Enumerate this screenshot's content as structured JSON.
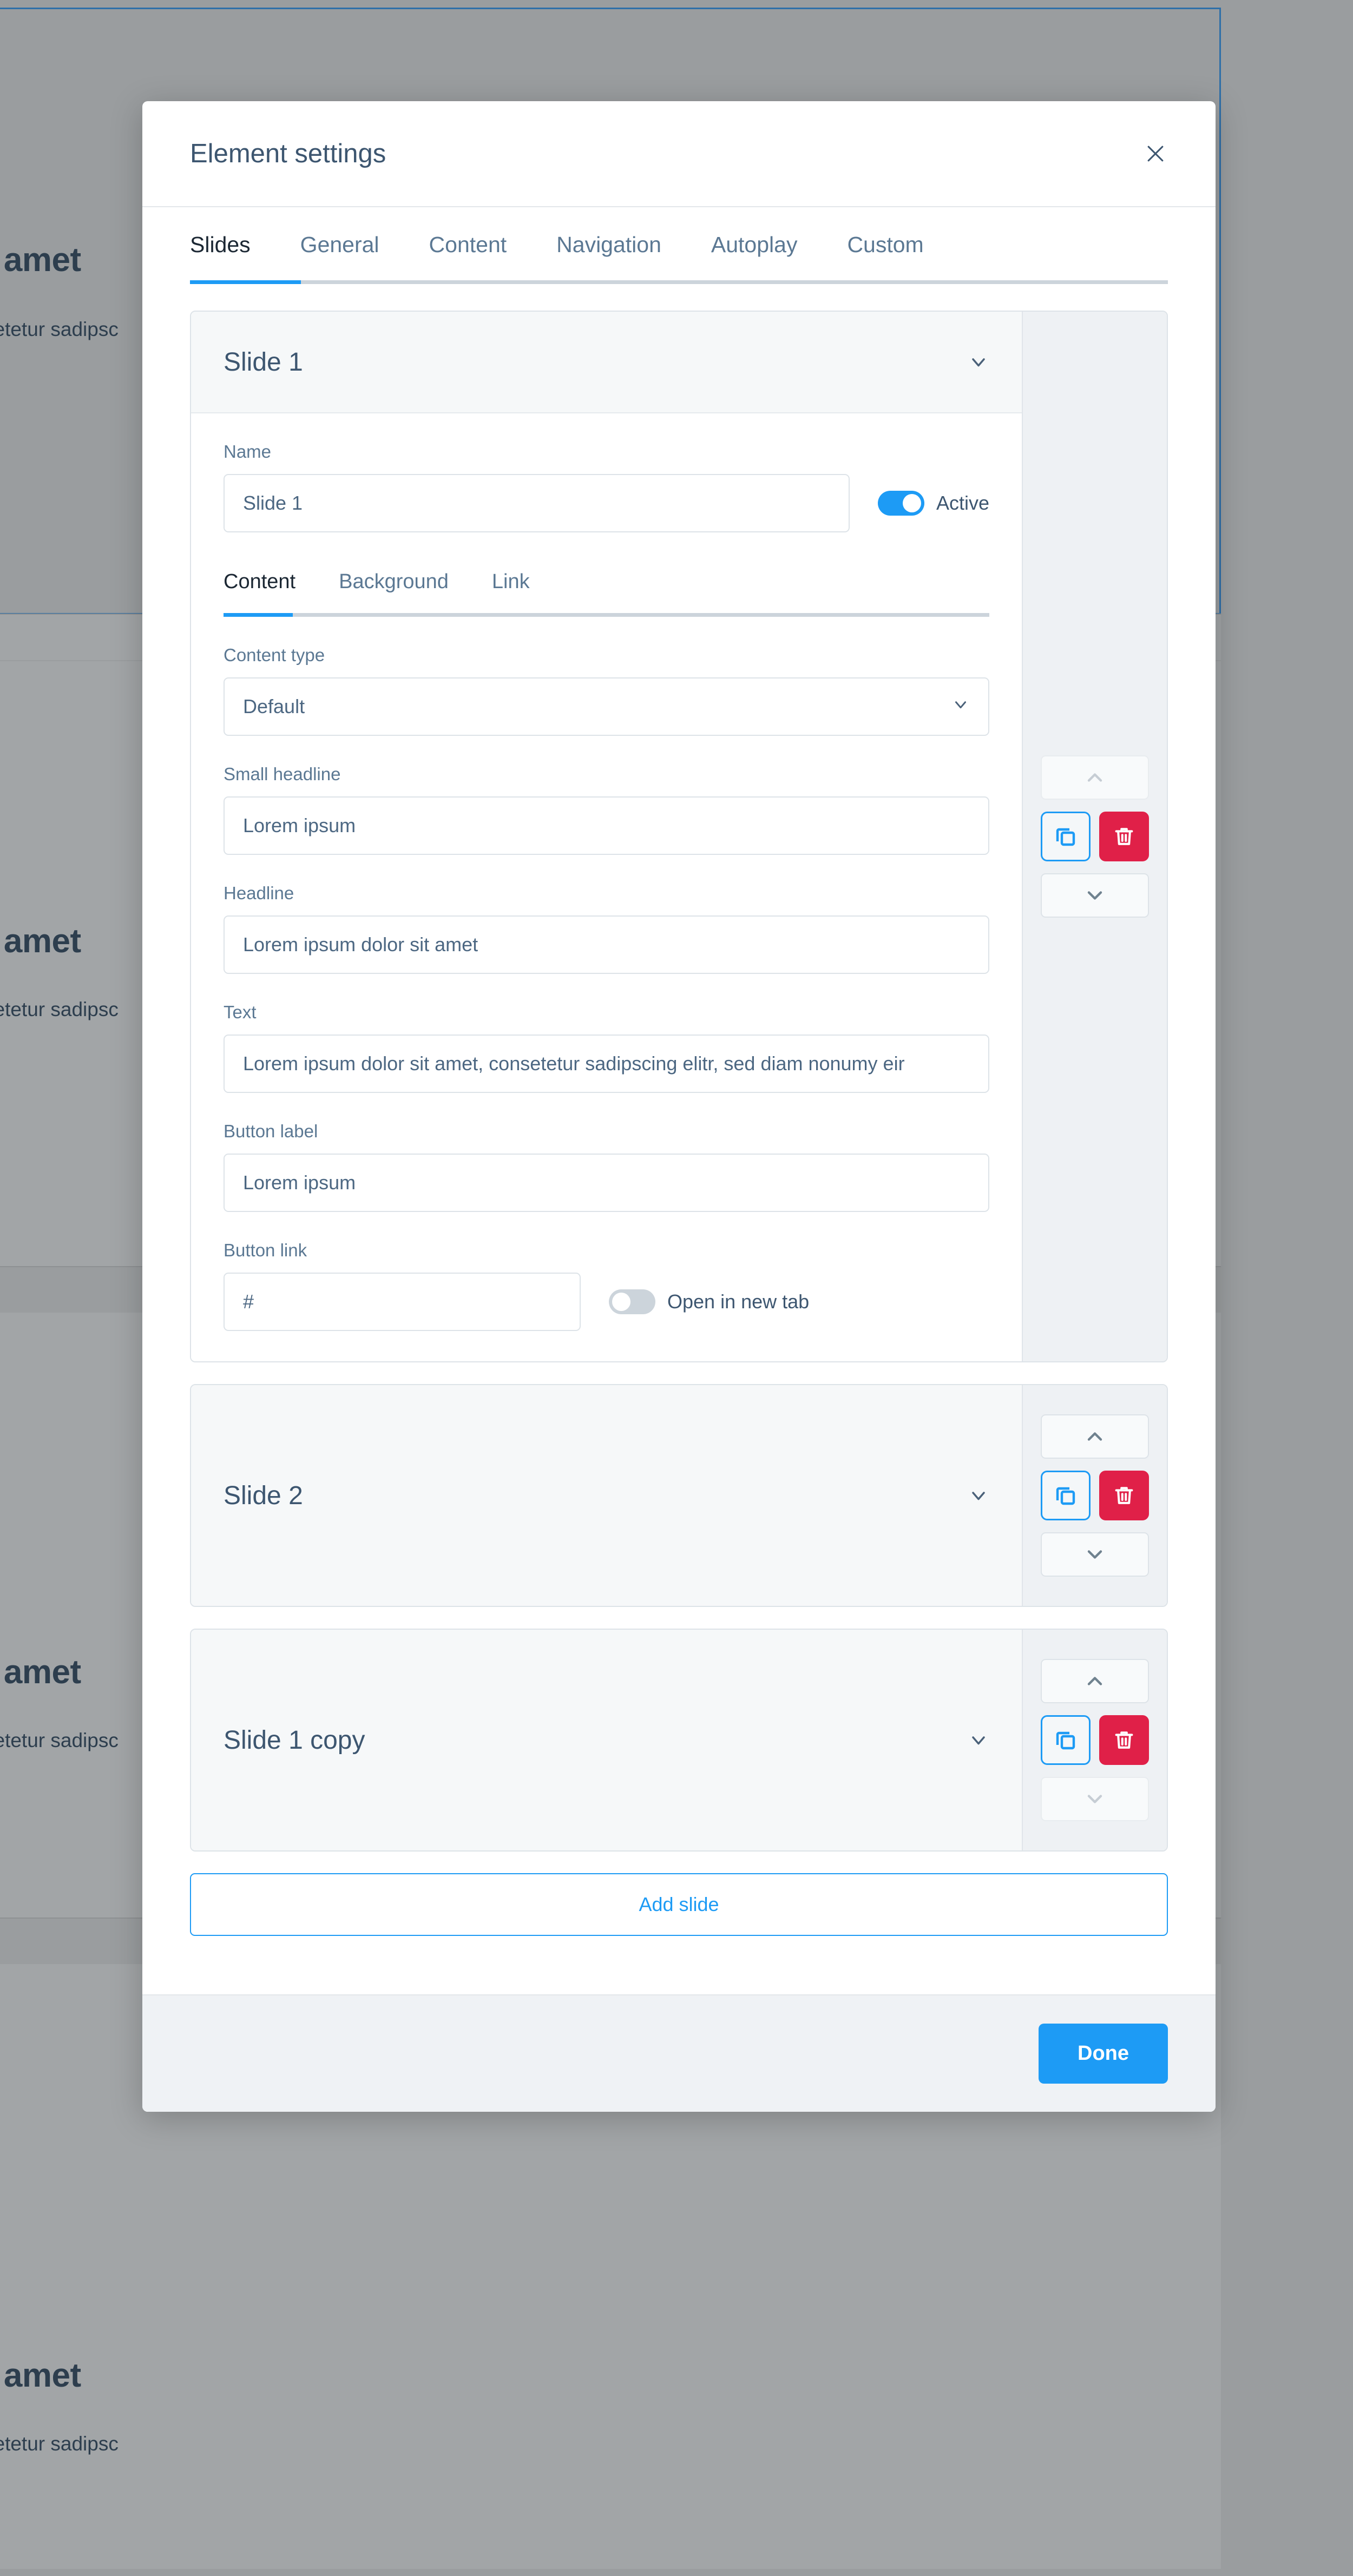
{
  "background": {
    "text_blocks": [
      {
        "headline": "t amet",
        "subline": "setetur sadipsc"
      },
      {
        "headline": "t amet",
        "subline": "setetur sadipsc"
      },
      {
        "headline": "t amet",
        "subline": "setetur sadipsc"
      },
      {
        "headline": "t amet",
        "subline": "setetur sadipsc"
      }
    ],
    "selection_color": "#2f6fa8"
  },
  "modal": {
    "title": "Element settings",
    "close_icon": "close-icon",
    "tabs": [
      {
        "label": "Slides",
        "active": true
      },
      {
        "label": "General",
        "active": false
      },
      {
        "label": "Content",
        "active": false
      },
      {
        "label": "Navigation",
        "active": false
      },
      {
        "label": "Autoplay",
        "active": false
      },
      {
        "label": "Custom",
        "active": false
      }
    ],
    "add_slide_label": "Add slide",
    "footer": {
      "done_label": "Done"
    },
    "accent_color": "#1d9bf5",
    "danger_color": "#e02048"
  },
  "slides": [
    {
      "title": "Slide 1",
      "expanded": true,
      "move_up_enabled": false,
      "move_down_enabled": true,
      "name_label": "Name",
      "name_value": "Slide 1",
      "active_toggle": {
        "label": "Active",
        "on": true
      },
      "inner_tabs": [
        {
          "label": "Content",
          "active": true
        },
        {
          "label": "Background",
          "active": false
        },
        {
          "label": "Link",
          "active": false
        }
      ],
      "fields": {
        "content_type_label": "Content type",
        "content_type_value": "Default",
        "small_headline_label": "Small headline",
        "small_headline_value": "Lorem ipsum",
        "headline_label": "Headline",
        "headline_value": "Lorem ipsum dolor sit amet",
        "text_label": "Text",
        "text_value": "Lorem ipsum dolor sit amet, consetetur sadipscing elitr, sed diam nonumy eir",
        "button_label_label": "Button label",
        "button_label_value": "Lorem ipsum",
        "button_link_label": "Button link",
        "button_link_value": "#",
        "new_tab_toggle": {
          "label": "Open in new tab",
          "on": false
        }
      }
    },
    {
      "title": "Slide 2",
      "expanded": false,
      "move_up_enabled": true,
      "move_down_enabled": true
    },
    {
      "title": "Slide 1 copy",
      "expanded": false,
      "move_up_enabled": true,
      "move_down_enabled": false
    }
  ]
}
